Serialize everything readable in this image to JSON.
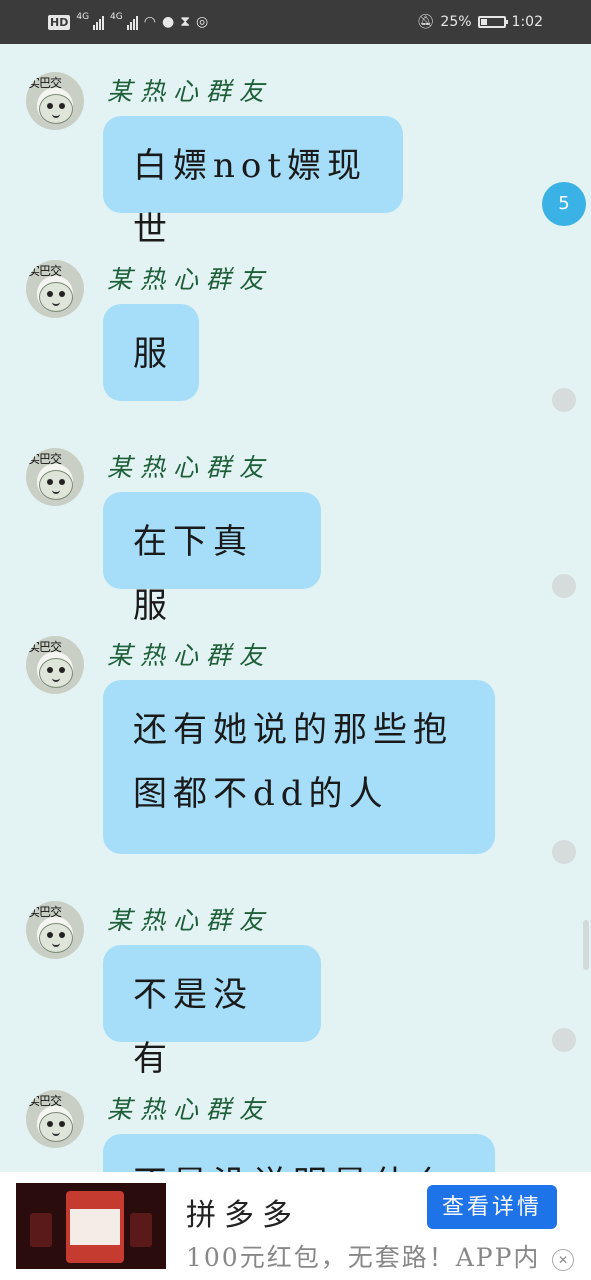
{
  "status_bar": {
    "left": [
      "HD",
      "4G",
      "4G"
    ],
    "battery_percent": "25%",
    "time": "1:02"
  },
  "chat": {
    "sender_name": "某热心群友",
    "avatar_caption": "实巴交",
    "unread_badge": "5",
    "messages": [
      {
        "lines": [
          "白嫖not嫖现世"
        ]
      },
      {
        "lines": [
          "服"
        ]
      },
      {
        "lines": [
          "在下真服"
        ]
      },
      {
        "lines": [
          "还有她说的那些抱",
          "图都不dd的人"
        ]
      },
      {
        "lines": [
          "不是没有"
        ]
      },
      {
        "lines": [
          "不是没说明是什么"
        ]
      }
    ]
  },
  "ad": {
    "title": "拼多多",
    "subtitle": "100元红包，无套路！APP内",
    "button_label": "查看详情",
    "close_icon": "close-icon"
  }
}
